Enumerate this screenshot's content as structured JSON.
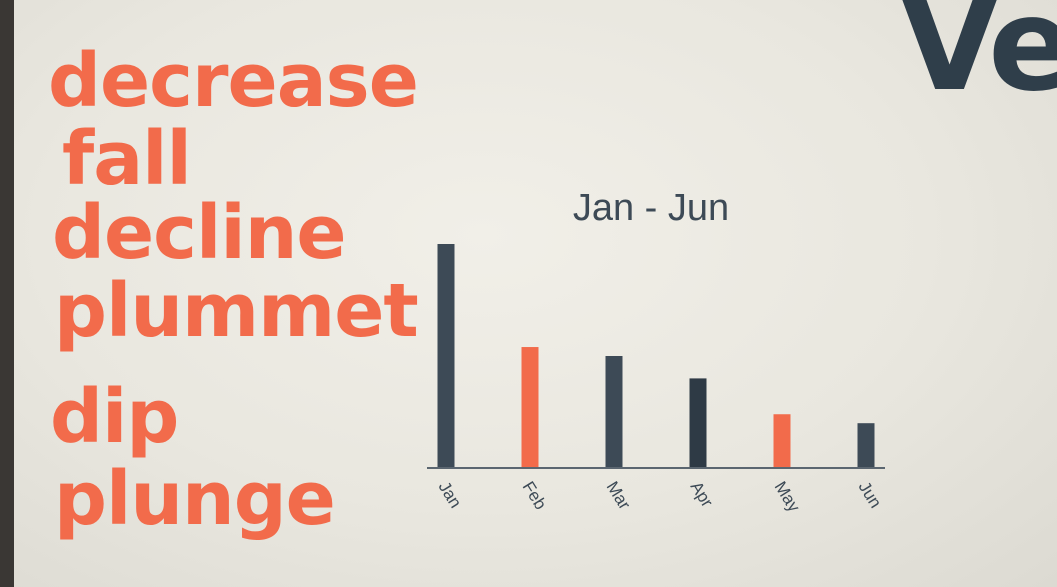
{
  "heading": "Ve",
  "words": [
    "decrease",
    "fall",
    "decline",
    "plummet",
    "dip",
    "plunge"
  ],
  "colors": {
    "dark": "#3d4a56",
    "accent": "#f26b4b",
    "axis": "#5b6670"
  },
  "chart_data": {
    "type": "bar",
    "title": "Jan - Jun",
    "xlabel": "",
    "ylabel": "",
    "categories": [
      "Jan",
      "Feb",
      "Mar",
      "Apr",
      "May",
      "Jun"
    ],
    "values": [
      100,
      54,
      50,
      40,
      24,
      20
    ],
    "bar_colors": [
      "#3d4a56",
      "#f26b4b",
      "#3d4a56",
      "#2e3a45",
      "#f26b4b",
      "#3d4a56"
    ],
    "ylim": [
      0,
      100
    ],
    "grid": false,
    "legend": "none"
  }
}
